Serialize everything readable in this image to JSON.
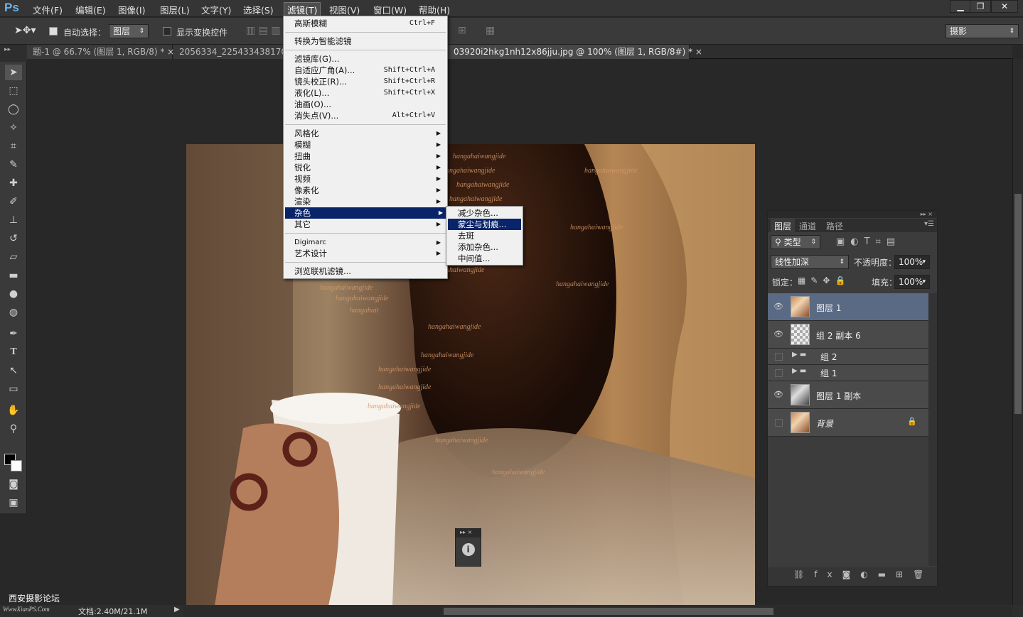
{
  "app": {
    "logo": "Ps"
  },
  "menubar": {
    "items": [
      "文件(F)",
      "编辑(E)",
      "图像(I)",
      "图层(L)",
      "文字(Y)",
      "选择(S)",
      "滤镜(T)",
      "视图(V)",
      "窗口(W)",
      "帮助(H)"
    ],
    "window_buttons": [
      "▁",
      "❐",
      "✕"
    ]
  },
  "options": {
    "auto_select_label": "自动选择：",
    "auto_select_value": "图层",
    "show_transform_label": "显示变换控件",
    "workspace": "摄影"
  },
  "tabs": [
    "题-1 @ 66.7% (图层 1, RGB/8) *",
    "2056334_225433438170...",
    "03920i2hkg1nh12x86jju.jpg @ 100% (图层 1, RGB/8#) *"
  ],
  "filter_menu": {
    "last_filter": "高斯模糊",
    "last_filter_shortcut": "Ctrl+F",
    "smart": "转换为智能滤镜",
    "group1": [
      {
        "label": "滤镜库(G)...",
        "shortcut": ""
      },
      {
        "label": "自适应广角(A)...",
        "shortcut": "Shift+Ctrl+A"
      },
      {
        "label": "镜头校正(R)...",
        "shortcut": "Shift+Ctrl+R"
      },
      {
        "label": "液化(L)...",
        "shortcut": "Shift+Ctrl+X"
      },
      {
        "label": "油画(O)...",
        "shortcut": ""
      },
      {
        "label": "消失点(V)...",
        "shortcut": "Alt+Ctrl+V"
      }
    ],
    "group2": [
      "风格化",
      "模糊",
      "扭曲",
      "锐化",
      "视频",
      "像素化",
      "渲染",
      "杂色",
      "其它"
    ],
    "group3": [
      "Digimarc",
      "艺术设计"
    ],
    "browse": "浏览联机滤镜..."
  },
  "noise_menu": [
    "减少杂色...",
    "蒙尘与划痕...",
    "去斑",
    "添加杂色...",
    "中间值..."
  ],
  "layers": {
    "tabs": [
      "图层",
      "通道",
      "路径"
    ],
    "kind": "类型",
    "blend_mode": "线性加深",
    "opacity_label": "不透明度：",
    "opacity": "100%",
    "lock_label": "锁定：",
    "fill_label": "填充：",
    "fill": "100%",
    "items": [
      {
        "name": "图层 1",
        "visible": true
      },
      {
        "name": "组 2 副本 6",
        "visible": true
      },
      {
        "name": "组 2",
        "visible": false
      },
      {
        "name": "组 1",
        "visible": false
      },
      {
        "name": "图层 1 副本",
        "visible": true
      },
      {
        "name": "背景",
        "visible": false
      }
    ],
    "footer_icons": [
      "link-icon",
      "fx-icon",
      "mask-icon",
      "adjustment-icon",
      "folder-icon",
      "new-layer-icon",
      "trash-icon"
    ]
  },
  "status": {
    "watermark": "西安摄影论坛",
    "watermark_url": "WwwXianPS.Com",
    "doc": "文档:2.40M/21.1M"
  },
  "canvas": {
    "text_pattern": "hangahaiwangjide"
  }
}
